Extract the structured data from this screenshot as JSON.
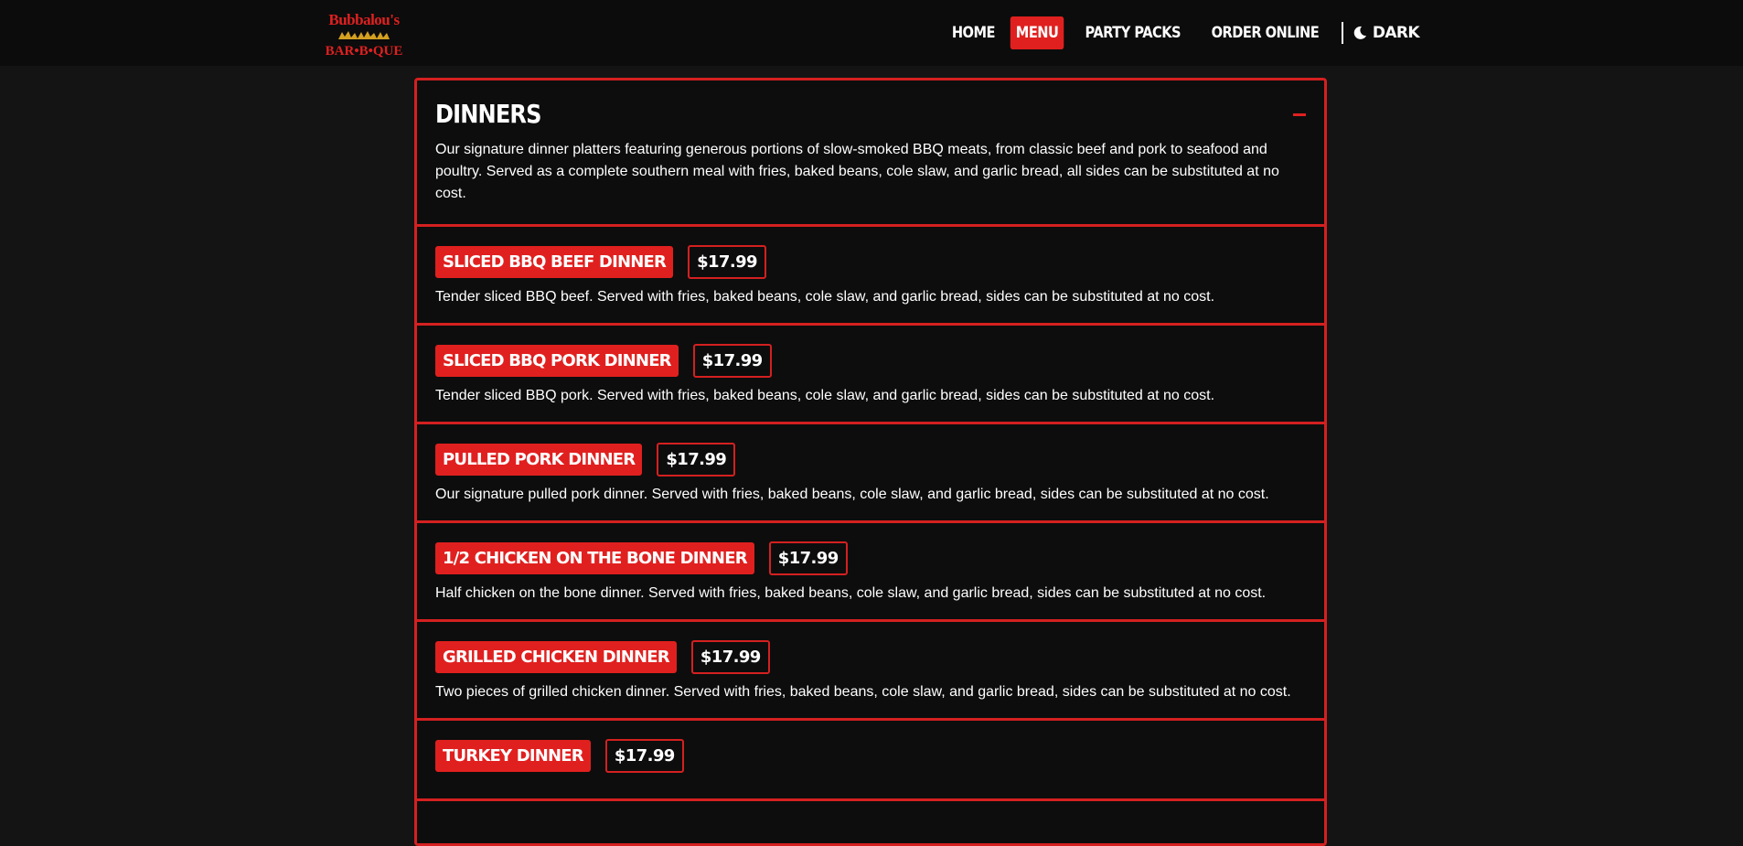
{
  "header": {
    "logo": {
      "line1": "Bubbalou's",
      "line2": "BAR•B•QUE"
    },
    "nav": {
      "home": "HOME",
      "menu": "MENU",
      "party_packs": "PARTY PACKS",
      "order_online": "ORDER ONLINE",
      "dark": "DARK"
    }
  },
  "section": {
    "title": "DINNERS",
    "description": "Our signature dinner platters featuring generous portions of slow-smoked BBQ meats, from classic beef and pork to seafood and poultry. Served as a complete southern meal with fries, baked beans, cole slaw, and garlic bread, all sides can be substituted at no cost.",
    "items": [
      {
        "name": "SLICED BBQ BEEF DINNER",
        "price": "$17.99",
        "description": "Tender sliced BBQ beef. Served with fries, baked beans, cole slaw, and garlic bread, sides can be substituted at no cost."
      },
      {
        "name": "SLICED BBQ PORK DINNER",
        "price": "$17.99",
        "description": "Tender sliced BBQ pork. Served with fries, baked beans, cole slaw, and garlic bread, sides can be substituted at no cost."
      },
      {
        "name": "PULLED PORK DINNER",
        "price": "$17.99",
        "description": "Our signature pulled pork dinner. Served with fries, baked beans, cole slaw, and garlic bread, sides can be substituted at no cost."
      },
      {
        "name": "1/2 CHICKEN ON THE BONE DINNER",
        "price": "$17.99",
        "description": "Half chicken on the bone dinner. Served with fries, baked beans, cole slaw, and garlic bread, sides can be substituted at no cost."
      },
      {
        "name": "GRILLED CHICKEN DINNER",
        "price": "$17.99",
        "description": "Two pieces of grilled chicken dinner. Served with fries, baked beans, cole slaw, and garlic bread, sides can be substituted at no cost."
      },
      {
        "name": "TURKEY DINNER",
        "price": "$17.99",
        "description": ""
      }
    ]
  },
  "colors": {
    "accent": "#e0201f",
    "background": "#141414",
    "panel": "#0d0d0d"
  }
}
